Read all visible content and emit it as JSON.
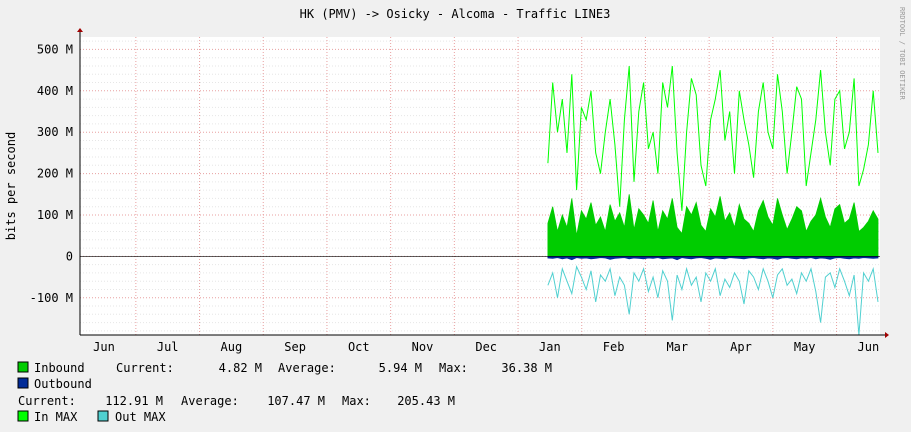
{
  "chart_data": {
    "type": "area",
    "title": "HK (PMV) -> Osicky - Alcoma - Traffic LINE3",
    "ylabel": "bits per second",
    "side_label": "RRDTOOL / TOBI OETIKER",
    "ylim": [
      -190,
      530
    ],
    "y_ticks": [
      {
        "value": 500,
        "label": "500 M"
      },
      {
        "value": 400,
        "label": "400 M"
      },
      {
        "value": 300,
        "label": "300 M"
      },
      {
        "value": 200,
        "label": "200 M"
      },
      {
        "value": 100,
        "label": "100 M"
      },
      {
        "value": 0,
        "label": "0"
      },
      {
        "value": -100,
        "label": "-100 M"
      }
    ],
    "months": [
      "Jun",
      "Jul",
      "Aug",
      "Sep",
      "Oct",
      "Nov",
      "Dec",
      "Jan",
      "Feb",
      "Mar",
      "Apr",
      "May",
      "Jun"
    ],
    "data_start_month_index": 7,
    "series": [
      {
        "name": "In MAX",
        "color": "#00ff00",
        "style": "line",
        "values": [
          225,
          420,
          300,
          380,
          250,
          440,
          160,
          360,
          330,
          400,
          250,
          200,
          300,
          380,
          270,
          120,
          330,
          460,
          180,
          350,
          420,
          260,
          300,
          200,
          420,
          360,
          460,
          250,
          110,
          300,
          430,
          390,
          220,
          170,
          330,
          380,
          450,
          280,
          350,
          200,
          400,
          330,
          270,
          190,
          350,
          420,
          300,
          260,
          440,
          350,
          200,
          300,
          410,
          380,
          170,
          250,
          330,
          450,
          300,
          220,
          380,
          400,
          260,
          300,
          430,
          170,
          210,
          270,
          400,
          250
        ]
      },
      {
        "name": "Inbound",
        "color": "#00cc00",
        "style": "area",
        "values": [
          80,
          120,
          60,
          100,
          70,
          140,
          50,
          110,
          90,
          130,
          75,
          95,
          60,
          125,
          85,
          105,
          70,
          150,
          65,
          115,
          100,
          80,
          135,
          60,
          110,
          90,
          140,
          70,
          55,
          120,
          100,
          130,
          75,
          60,
          115,
          95,
          145,
          85,
          105,
          70,
          125,
          90,
          80,
          60,
          110,
          135,
          95,
          75,
          140,
          100,
          65,
          90,
          120,
          110,
          60,
          85,
          100,
          140,
          95,
          70,
          115,
          125,
          80,
          90,
          130,
          60,
          70,
          85,
          110,
          90
        ],
        "legend_stats": {
          "current": "4.82 M",
          "average": "5.94 M",
          "max": "36.38 M"
        }
      },
      {
        "name": "Outbound",
        "color": "#002a97",
        "style": "area",
        "values": [
          -4,
          -5,
          -3,
          -6,
          -4,
          -8,
          -3,
          -5,
          -4,
          -6,
          -5,
          -3,
          -4,
          -7,
          -5,
          -4,
          -3,
          -6,
          -4,
          -5,
          -6,
          -4,
          -5,
          -3,
          -6,
          -5,
          -4,
          -8,
          -3,
          -5,
          -6,
          -4,
          -3,
          -5,
          -7,
          -4,
          -5,
          -6,
          -3,
          -4,
          -5,
          -6,
          -4,
          -3,
          -5,
          -6,
          -4,
          -5,
          -7,
          -4,
          -3,
          -5,
          -6,
          -4,
          -5,
          -3,
          -6,
          -4,
          -5,
          -7,
          -4,
          -3,
          -5,
          -6,
          -4,
          -5,
          -3,
          -4,
          -5,
          -4
        ],
        "legend_stats": {
          "current": "112.91 M",
          "average": "107.47 M",
          "max": "205.43 M"
        }
      },
      {
        "name": "Out MAX",
        "color": "#50d0d0",
        "style": "line",
        "values": [
          -70,
          -40,
          -100,
          -30,
          -60,
          -90,
          -25,
          -50,
          -80,
          -35,
          -110,
          -45,
          -60,
          -30,
          -95,
          -50,
          -70,
          -140,
          -40,
          -60,
          -30,
          -85,
          -50,
          -100,
          -35,
          -60,
          -155,
          -45,
          -80,
          -30,
          -70,
          -50,
          -110,
          -40,
          -60,
          -30,
          -95,
          -55,
          -75,
          -40,
          -60,
          -115,
          -35,
          -50,
          -80,
          -30,
          -60,
          -100,
          -45,
          -30,
          -70,
          -55,
          -90,
          -40,
          -60,
          -30,
          -85,
          -160,
          -50,
          -40,
          -75,
          -30,
          -60,
          -95,
          -45,
          -190,
          -40,
          -60,
          -30,
          -110
        ]
      }
    ],
    "legend": {
      "inbound_label": "Inbound",
      "outbound_label": "Outbound",
      "inmax_label": "In MAX",
      "outmax_label": "Out MAX",
      "current_label": "Current:",
      "average_label": "Average:",
      "max_label": "Max:"
    }
  }
}
